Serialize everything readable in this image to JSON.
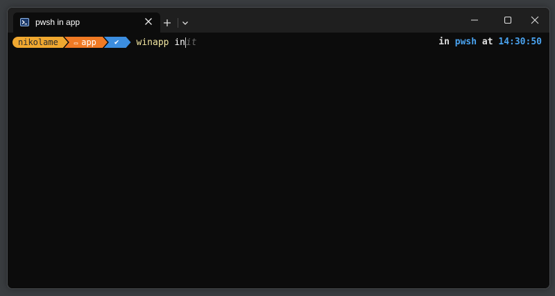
{
  "window": {
    "tab_title": "pwsh in app",
    "tab_icon": "powershell-icon",
    "controls": [
      "minimize-icon",
      "maximize-icon",
      "close-icon"
    ]
  },
  "prompt": {
    "user": "nikolame",
    "directory": "app",
    "folder_glyph": "▭",
    "git_status": "✔",
    "command_name": "winapp",
    "command_typed": " in",
    "autosuggest": "it"
  },
  "right_prompt": {
    "word_in": "in ",
    "shell": "pwsh",
    "word_at": " at ",
    "time": "14:30:50"
  },
  "colors": {
    "terminal_bg": "#0c0c0c",
    "user_segment": "#f0a830",
    "dir_segment": "#f07a24",
    "git_segment": "#3c8ee0",
    "accent_blue": "#4aa3f0"
  }
}
